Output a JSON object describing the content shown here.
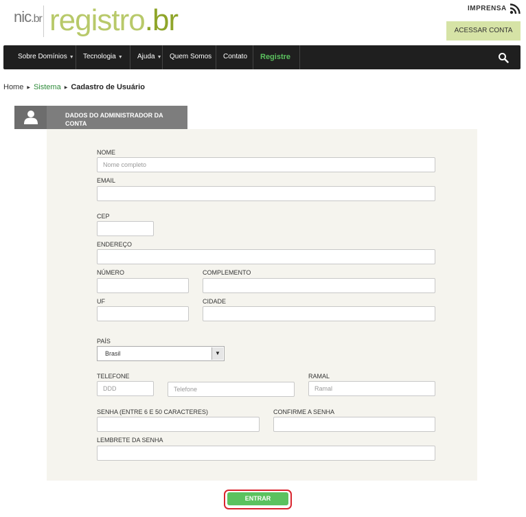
{
  "header": {
    "logo_nic": "nic",
    "logo_nic_br": ".br",
    "logo_registro": "registro",
    "logo_registro_br": ".br",
    "imprensa": "IMPRENSA",
    "acessar_conta": "ACESSAR CONTA"
  },
  "nav": {
    "items": [
      {
        "label": "Sobre Domínios",
        "caret": "▼"
      },
      {
        "label": "Tecnologia",
        "caret": "▼"
      },
      {
        "label": "Ajuda",
        "caret": "▼"
      },
      {
        "label": "Quem Somos"
      },
      {
        "label": "Contato"
      },
      {
        "label": "Registre"
      }
    ],
    "accent_color": "#5bc25f"
  },
  "breadcrumb": {
    "home": "Home",
    "sistema": "Sistema",
    "current": "Cadastro de Usuário",
    "separator": "▶"
  },
  "section": {
    "title": "DADOS DO ADMINISTRADOR DA CONTA"
  },
  "form": {
    "nome_label": "NOME",
    "nome_placeholder": "Nome completo",
    "email_label": "EMAIL",
    "cep_label": "CEP",
    "endereco_label": "ENDEREÇO",
    "numero_label": "NÚMERO",
    "complemento_label": "COMPLEMENTO",
    "uf_label": "UF",
    "cidade_label": "CIDADE",
    "pais_label": "PAÍS",
    "pais_value": "Brasil",
    "telefone_label": "TELEFONE",
    "ddd_placeholder": "DDD",
    "telefone_placeholder": "Telefone",
    "ramal_label": "RAMAL",
    "ramal_placeholder": "Ramal",
    "senha_label": "SENHA (ENTRE 6 E 50 CARACTERES)",
    "confirme_label": "CONFIRME A SENHA",
    "lembrete_label": "LEMBRETE DA SENHA",
    "submit_label": "ENTRAR"
  }
}
